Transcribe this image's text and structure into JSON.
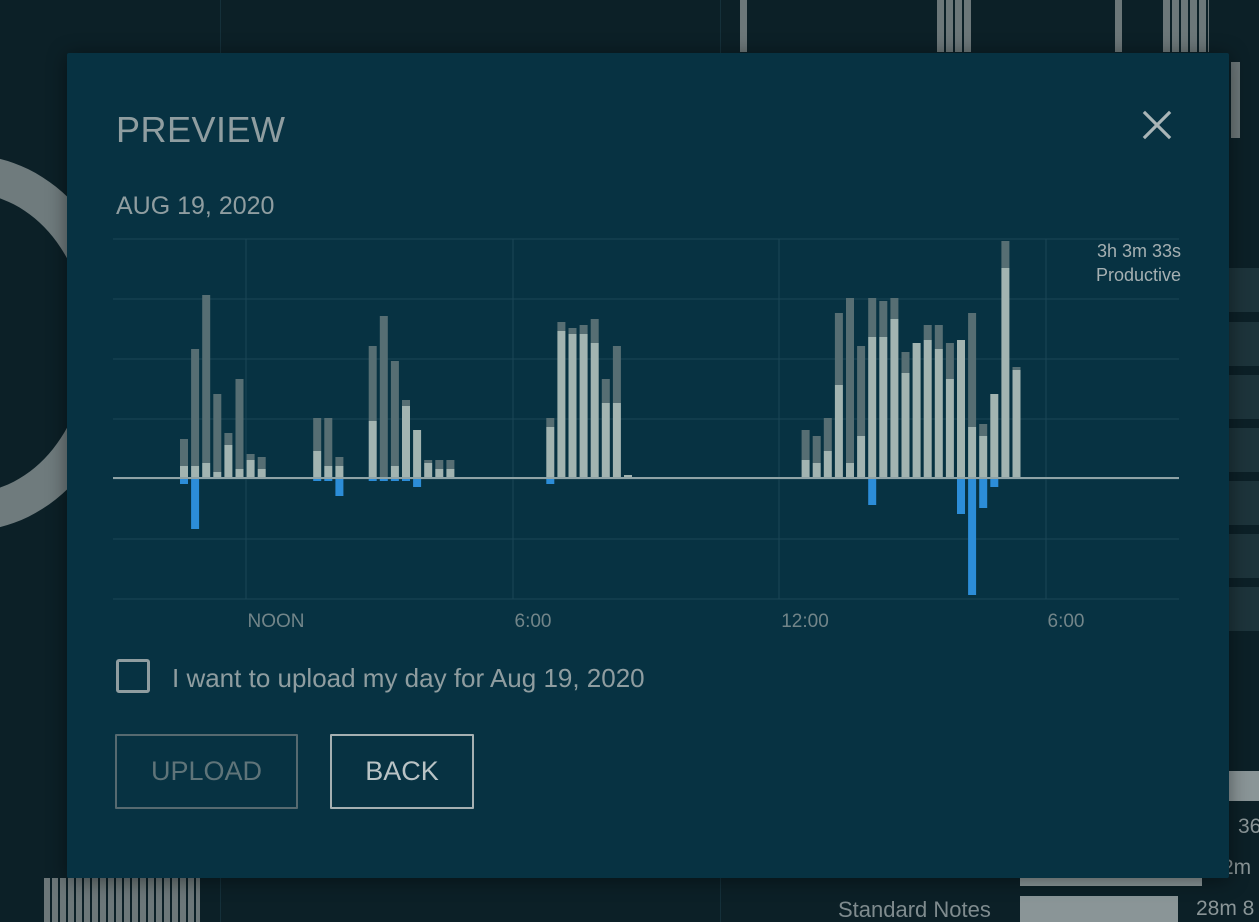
{
  "modal": {
    "title": "PREVIEW",
    "date": "AUG 19, 2020",
    "checkbox_label": "I want to upload my day for Aug 19, 2020",
    "checkbox_checked": false,
    "upload_label": "UPLOAD",
    "upload_enabled": false,
    "back_label": "BACK"
  },
  "chart_data": {
    "type": "bar",
    "stacked": true,
    "summary": {
      "total": "3h 3m 33s",
      "label": "Productive"
    },
    "x_ticks": [
      "NOON",
      "6:00",
      "12:00",
      "6:00"
    ],
    "y_range": [
      -40,
      80
    ],
    "grid": true,
    "colors": {
      "productive": "#a2b4b1",
      "neutral": "#566e73",
      "distracting": "#2c8dd8",
      "axis": "#8fa3a6",
      "grid": "#1b4656"
    },
    "series": [
      {
        "name": "productive",
        "values": [
          4,
          4,
          5,
          2,
          11,
          3,
          6,
          3,
          0,
          0,
          0,
          0,
          9,
          4,
          4,
          0,
          0,
          19,
          0,
          4,
          24,
          16,
          5,
          3,
          3,
          0,
          0,
          0,
          0,
          0,
          0,
          0,
          0,
          17,
          49,
          48,
          48,
          45,
          25,
          25,
          1,
          0,
          0,
          0,
          0,
          0,
          0,
          0,
          0,
          0,
          0,
          0,
          0,
          0,
          0,
          0,
          6,
          5,
          9,
          31,
          5,
          14,
          47,
          47,
          53,
          35,
          45,
          46,
          43,
          33,
          46,
          17,
          14,
          28,
          70,
          36
        ]
      },
      {
        "name": "neutral",
        "values": [
          9,
          39,
          56,
          26,
          4,
          30,
          2,
          4,
          0,
          0,
          0,
          0,
          11,
          16,
          3,
          0,
          0,
          25,
          54,
          35,
          2,
          0,
          1,
          3,
          3,
          0,
          0,
          0,
          0,
          0,
          0,
          0,
          0,
          3,
          3,
          2,
          3,
          8,
          8,
          19,
          0,
          0,
          0,
          0,
          0,
          0,
          0,
          0,
          0,
          0,
          0,
          0,
          0,
          0,
          0,
          0,
          10,
          9,
          11,
          24,
          55,
          30,
          13,
          12,
          7,
          7,
          0,
          5,
          8,
          12,
          0,
          38,
          4,
          0,
          9,
          1
        ]
      },
      {
        "name": "distracting",
        "values": [
          -2,
          -17,
          0,
          0,
          0,
          0,
          0,
          0,
          0,
          0,
          0,
          0,
          -1,
          -1,
          -6,
          0,
          0,
          -1,
          -1,
          -1,
          -1,
          -3,
          0,
          0,
          0,
          0,
          0,
          0,
          0,
          0,
          0,
          0,
          0,
          -2,
          0,
          0,
          0,
          0,
          0,
          0,
          0,
          0,
          0,
          0,
          0,
          0,
          0,
          0,
          0,
          0,
          0,
          0,
          0,
          0,
          0,
          0,
          0,
          0,
          0,
          0,
          0,
          0,
          -9,
          0,
          0,
          0,
          0,
          0,
          0,
          0,
          -12,
          -39,
          -10,
          -3,
          0,
          0
        ]
      }
    ]
  }
}
